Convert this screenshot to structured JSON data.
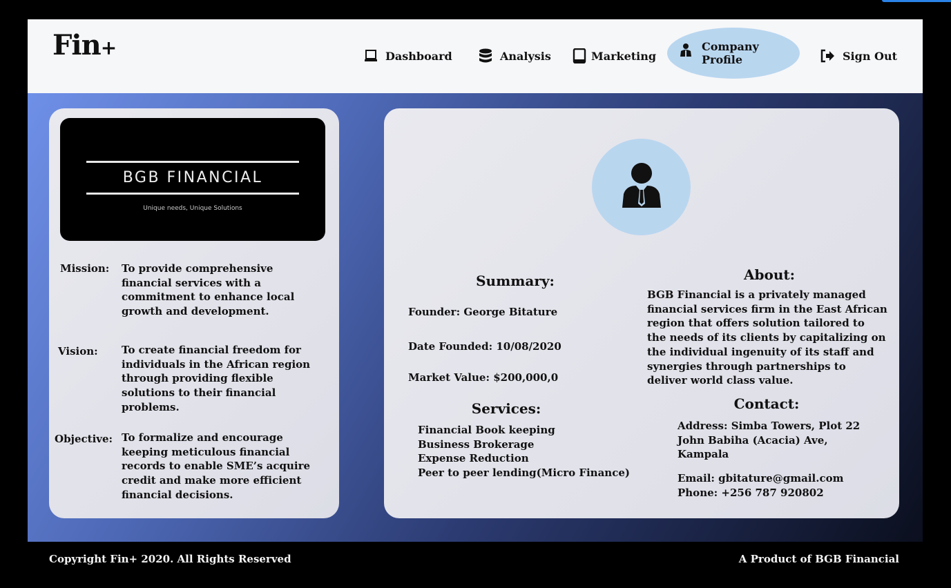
{
  "brand": {
    "name": "Fin",
    "plus": "+"
  },
  "nav": [
    {
      "id": "dashboard",
      "label": "Dashboard",
      "icon": "laptop-icon"
    },
    {
      "id": "analysis",
      "label": "Analysis",
      "icon": "database-icon"
    },
    {
      "id": "marketing",
      "label": "Marketing",
      "icon": "tablet-icon"
    },
    {
      "id": "company-profile",
      "label": "Company Profile",
      "icon": "users-icon",
      "active": true
    },
    {
      "id": "sign-out",
      "label": "Sign Out",
      "icon": "sign-out-icon"
    }
  ],
  "logo": {
    "name": "BGB FINANCIAL",
    "tagline": "Unique needs, Unique Solutions"
  },
  "statements": {
    "mission": {
      "label": "Mission:",
      "text": "To provide comprehensive financial services with a commitment to enhance local growth and development."
    },
    "vision": {
      "label": "Vision:",
      "text": "To create financial freedom for individuals in the African region through providing flexible solutions to their financial problems."
    },
    "objective": {
      "label": "Objective:",
      "text": "To formalize and encourage keeping meticulous financial records to enable SME’s acquire credit and make more efficient financial decisions."
    }
  },
  "summary": {
    "heading": "Summary:",
    "founder": "Founder: George Bitature",
    "date_founded": "Date Founded: 10/08/2020",
    "market_value": "Market Value: $200,000,0"
  },
  "services": {
    "heading": "Services:",
    "items": [
      "Financial Book keeping",
      "Business Brokerage",
      "Expense Reduction",
      "Peer to peer lending(Micro Finance)"
    ]
  },
  "about": {
    "heading": "About:",
    "lines": [
      "BGB Financial is a privately managed",
      "financial services firm in the East African",
      "region that offers solution tailored to",
      "the needs of its clients by capitalizing on",
      "the individual ingenuity of its staff and",
      "synergies through partnerships to",
      "deliver world class value."
    ]
  },
  "contact": {
    "heading": "Contact:",
    "address_lines": [
      "Address: Simba Towers, Plot 22",
      "John Babiha (Acacia) Ave,",
      "Kampala"
    ],
    "email": "Email: gbitature@gmail.com",
    "phone": "Phone: +256 787 920802"
  },
  "footer": {
    "copyright": "Copyright Fin+ 2020. All Rights Reserved",
    "product": "A Product of BGB Financial"
  },
  "colors": {
    "active_nav": "#b9d6ef",
    "avatar_bg": "#b9d6ef",
    "accent_top": "#2a83e8"
  }
}
